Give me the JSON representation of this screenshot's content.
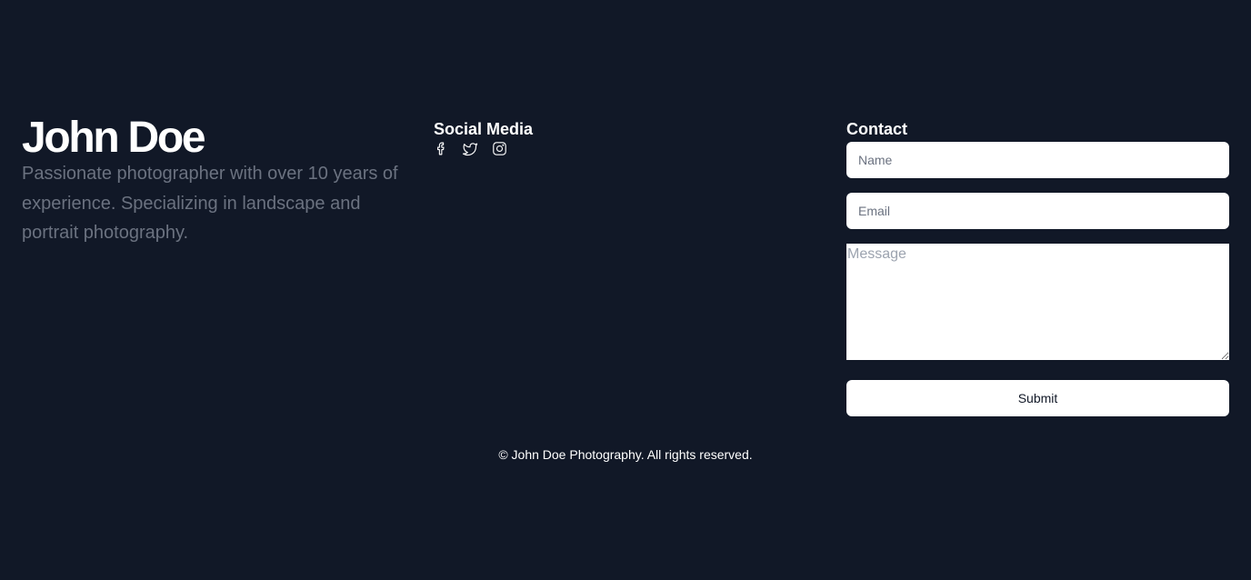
{
  "about": {
    "name": "John Doe",
    "bio": "Passionate photographer with over 10 years of experience. Specializing in landscape and portrait photography."
  },
  "social": {
    "title": "Social Media",
    "icons": [
      "facebook-icon",
      "twitter-icon",
      "instagram-icon"
    ]
  },
  "contact": {
    "title": "Contact",
    "name_placeholder": "Name",
    "email_placeholder": "Email",
    "message_placeholder": "Message",
    "submit_label": "Submit"
  },
  "footer": {
    "copyright": "© John Doe Photography. All rights reserved."
  },
  "colors": {
    "background": "#111827",
    "text": "#ffffff",
    "muted": "#6b7280"
  }
}
